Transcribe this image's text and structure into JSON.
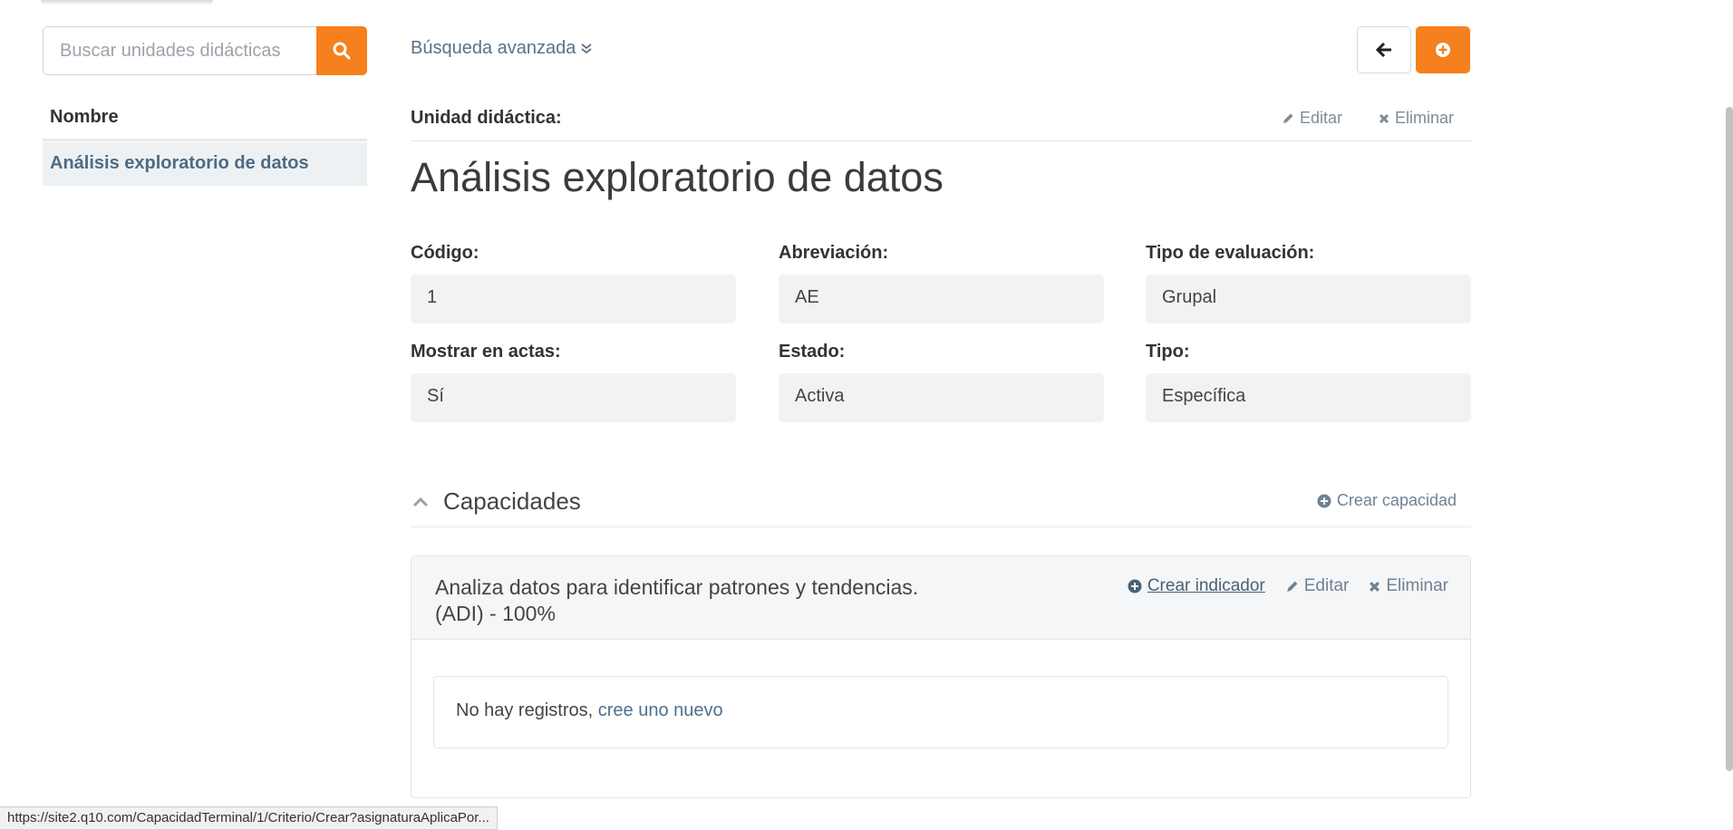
{
  "search": {
    "placeholder": "Buscar unidades didácticas"
  },
  "list": {
    "header": "Nombre",
    "items": [
      {
        "label": "Análisis exploratorio de datos"
      }
    ]
  },
  "advanced_search": {
    "label": "Búsqueda avanzada"
  },
  "section": {
    "label": "Unidad didáctica:",
    "edit": "Editar",
    "delete": "Eliminar"
  },
  "title": "Análisis exploratorio de datos",
  "fields": {
    "codigo": {
      "label": "Código:",
      "value": "1"
    },
    "abreviacion": {
      "label": "Abreviación:",
      "value": "AE"
    },
    "tipo_evaluacion": {
      "label": "Tipo de evaluación:",
      "value": "Grupal"
    },
    "mostrar_actas": {
      "label": "Mostrar en actas:",
      "value": "Sí"
    },
    "estado": {
      "label": "Estado:",
      "value": "Activa"
    },
    "tipo": {
      "label": "Tipo:",
      "value": "Específica"
    }
  },
  "capacidades": {
    "title": "Capacidades",
    "create": "Crear capacidad",
    "card": {
      "title": "Analiza datos para identificar patrones y tendencias. (ADI) - 100%",
      "create_indicator": "Crear indicador",
      "edit": "Editar",
      "delete": "Eliminar",
      "empty_text": "No hay registros,",
      "empty_link": "cree uno nuevo"
    }
  },
  "status_bar": {
    "url": "https://site2.q10.com/CapacidadTerminal/1/Criterio/Crear?asignaturaAplicaPor..."
  },
  "colors": {
    "accent": "#f7801e",
    "link": "#4d7090"
  }
}
